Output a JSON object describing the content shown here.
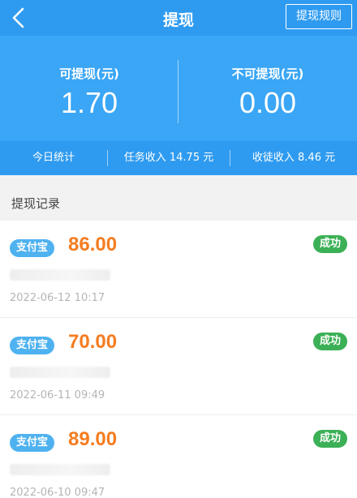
{
  "header": {
    "title": "提现",
    "rules_label": "提现规则"
  },
  "summary": {
    "withdrawable_label": "可提现(元)",
    "withdrawable_value": "1.70",
    "non_withdrawable_label": "不可提现(元)",
    "non_withdrawable_value": "0.00"
  },
  "stats": {
    "today": "今日统计",
    "task_income": "任务收入 14.75 元",
    "apprentice_income": "收徒收入 8.46 元"
  },
  "section_title": "提现记录",
  "records": [
    {
      "method": "支付宝",
      "amount": "86.00",
      "status": "成功",
      "time": "2022-06-12 10:17"
    },
    {
      "method": "支付宝",
      "amount": "70.00",
      "status": "成功",
      "time": "2022-06-11 09:49"
    },
    {
      "method": "支付宝",
      "amount": "89.00",
      "status": "成功",
      "time": "2022-06-10 09:47"
    }
  ],
  "colors": {
    "header": "#2f9bf0",
    "summary": "#3aa6f5",
    "amount": "#f57c1f",
    "success": "#3cb056",
    "badge": "#4fb2f0"
  },
  "icons": {
    "back": "chevron-left-icon"
  }
}
